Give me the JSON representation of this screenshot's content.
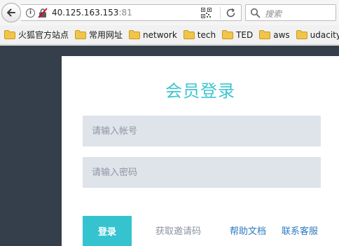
{
  "browser": {
    "url_host": "40.125.163.153",
    "url_port": ":81",
    "search_placeholder": "搜索",
    "bookmarks": [
      {
        "label": "火狐官方站点",
        "icon": "folder-icon"
      },
      {
        "label": "常用网址",
        "icon": "folder-icon"
      },
      {
        "label": "network",
        "icon": "folder-icon"
      },
      {
        "label": "tech",
        "icon": "folder-icon"
      },
      {
        "label": "TED",
        "icon": "folder-icon"
      },
      {
        "label": "aws",
        "icon": "folder-icon"
      },
      {
        "label": "udacity",
        "icon": "folder-icon"
      }
    ]
  },
  "login": {
    "title": "会员登录",
    "account_placeholder": "请输入帐号",
    "password_placeholder": "请输入密码",
    "login_button": "登录",
    "invite_link": "获取邀请码",
    "help_link": "帮助文档",
    "contact_link": "联系客服"
  },
  "colors": {
    "accent": "#35c3cf",
    "page_background": "#353f4b",
    "field_background": "#dfe3ea",
    "link_blue": "#2a79c2"
  }
}
